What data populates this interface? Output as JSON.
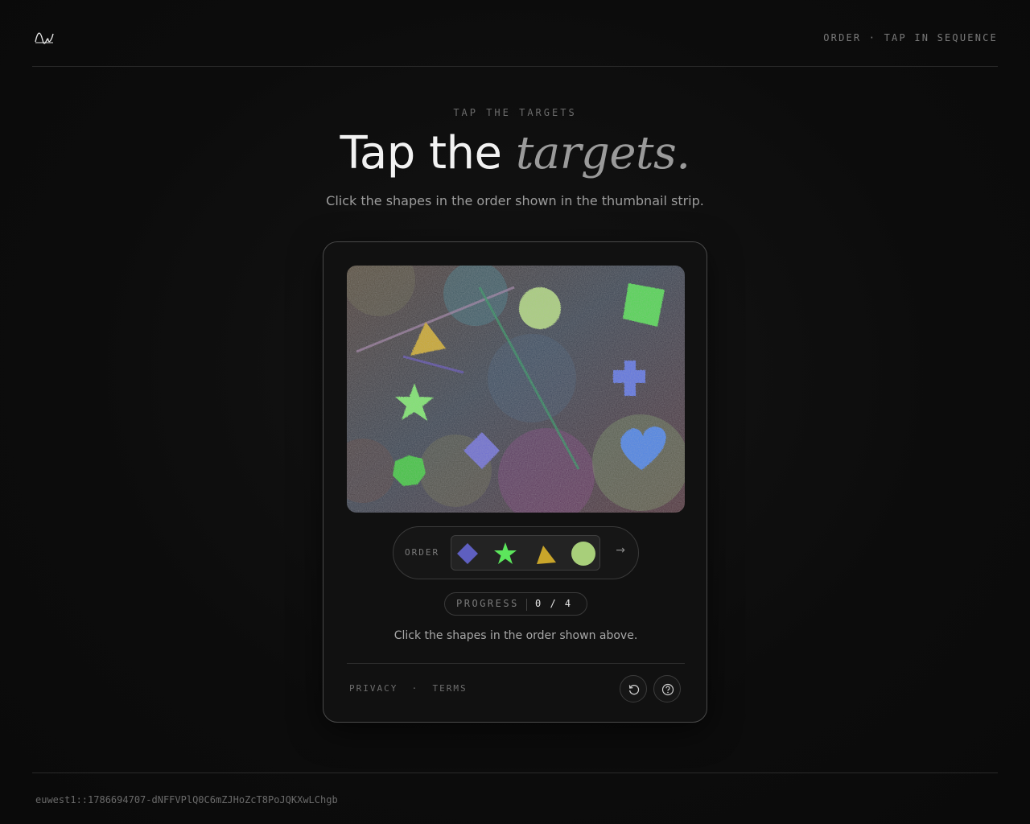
{
  "header": {
    "tag": "ORDER · TAP IN SEQUENCE",
    "logo_icon": "wave-logo-icon"
  },
  "hero": {
    "eyebrow": "TAP THE TARGETS",
    "title_plain": "Tap the",
    "title_emphasis": "targets.",
    "subtitle": "Click the shapes in the order shown in the thumbnail strip."
  },
  "challenge": {
    "canvas_shapes": [
      "triangle",
      "circle",
      "square",
      "star",
      "cross",
      "diamond",
      "heart",
      "heptagon",
      "line",
      "line",
      "line"
    ],
    "order_label": "ORDER",
    "order_sequence": [
      "diamond",
      "star",
      "triangle",
      "circle"
    ],
    "order_colors": [
      "#5e5fc0",
      "#5ce65c",
      "#c9a52a",
      "#a8cf7a"
    ],
    "next_arrow": "→",
    "progress_label": "PROGRESS",
    "progress_value": "0 / 4",
    "instruction": "Click the shapes in the order shown above."
  },
  "card_footer": {
    "privacy": "PRIVACY",
    "separator": "·",
    "terms": "TERMS",
    "reload_icon": "refresh-icon",
    "help_icon": "help-circle-icon"
  },
  "footer": {
    "session_id": "euwest1::1786694707-dNFFVPlQ0C6mZJHoZcT8PoJQKXwLChgb"
  },
  "colors": {
    "background": "#0c0c0c",
    "card_border": "#4a4a4a",
    "accent_text": "#f2f2f2",
    "muted_text": "#7a7a7a"
  }
}
